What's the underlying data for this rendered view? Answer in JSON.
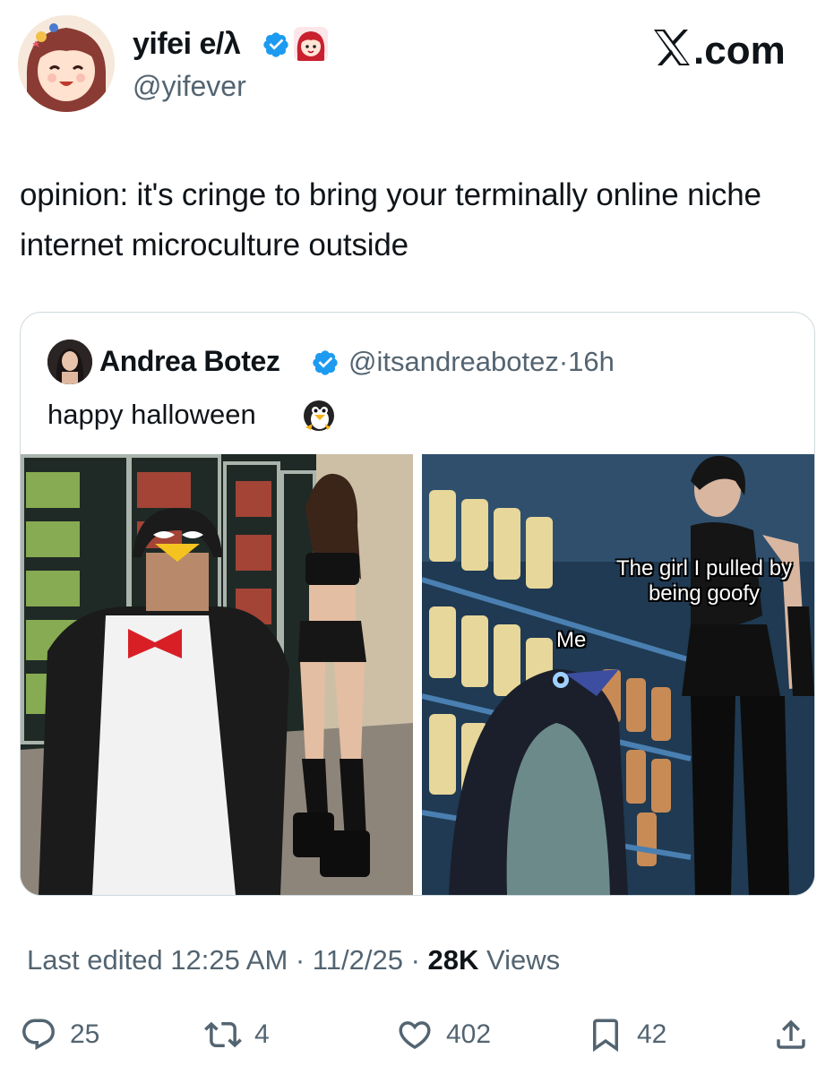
{
  "author": {
    "display_name": "yifei e/λ",
    "handle": "@yifever",
    "verified_icon": "verified-badge-icon",
    "badge_icon": "anime-character-badge-icon"
  },
  "brand": {
    "label": "X.com",
    "color": "#0f1419"
  },
  "tweet": {
    "text": "opinion: it's cringe to bring your terminally online niche internet microculture outside"
  },
  "quote": {
    "display_name": "Andrea Botez",
    "handle": "@itsandreabotez",
    "separator": "·",
    "time": "16h",
    "text": "happy halloween",
    "emoji": "penguin-emoji",
    "meme_label_me": "Me",
    "meme_label_girl_line1": "The girl I pulled by",
    "meme_label_girl_line2": "being goofy"
  },
  "meta": {
    "edited_label": "Last edited 12:25 AM · 11/2/25",
    "separator": " · ",
    "views_count": "28K",
    "views_label": " Views"
  },
  "actions": {
    "replies": "25",
    "reposts": "4",
    "likes": "402",
    "bookmarks": "42"
  },
  "colors": {
    "verified": "#1d9bf0",
    "muted": "#536471",
    "border": "#cfd9de"
  }
}
